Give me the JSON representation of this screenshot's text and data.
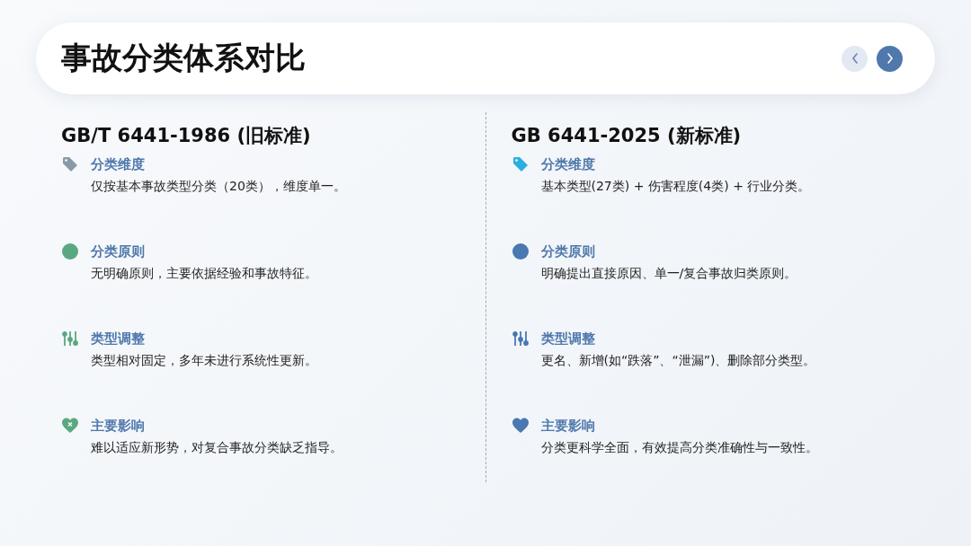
{
  "header": {
    "title": "事故分类体系对比",
    "nav": [
      {
        "kind": "prev",
        "disabled": true
      },
      {
        "kind": "next",
        "disabled": false
      }
    ]
  },
  "columns": [
    {
      "heading": "GB/T 6441-1986 (旧标准)",
      "items": [
        {
          "title": "分类维度",
          "text": "仅按基本事故类型分类（20类），维度单一。",
          "color": "#8a99a8"
        },
        {
          "title": "分类原则",
          "text": "无明确原则，主要依据经验和事故特征。",
          "color": "#5aa880"
        },
        {
          "title": "类型调整",
          "text": "类型相对固定，多年未进行系统性更新。",
          "color": "#5aa880"
        },
        {
          "title": "主要影响",
          "text": "难以适应新形势，对复合事故分类缺乏指导。",
          "color": "#5aa880"
        }
      ]
    },
    {
      "heading": "GB 6441-2025 (新标准)",
      "items": [
        {
          "title": "分类维度",
          "text": "基本类型(27类) + 伤害程度(4类) + 行业分类。",
          "color": "#2ab0e0"
        },
        {
          "title": "分类原则",
          "text": "明确提出直接原因、单一/复合事故归类原则。",
          "color": "#4a78b0"
        },
        {
          "title": "类型调整",
          "text": "更名、新增(如“跌落”、“泄漏”)、删除部分类型。",
          "color": "#4a78b0"
        },
        {
          "title": "主要影响",
          "text": "分类更科学全面，有效提高分类准确性与一致性。",
          "color": "#4a78b0"
        }
      ]
    }
  ]
}
